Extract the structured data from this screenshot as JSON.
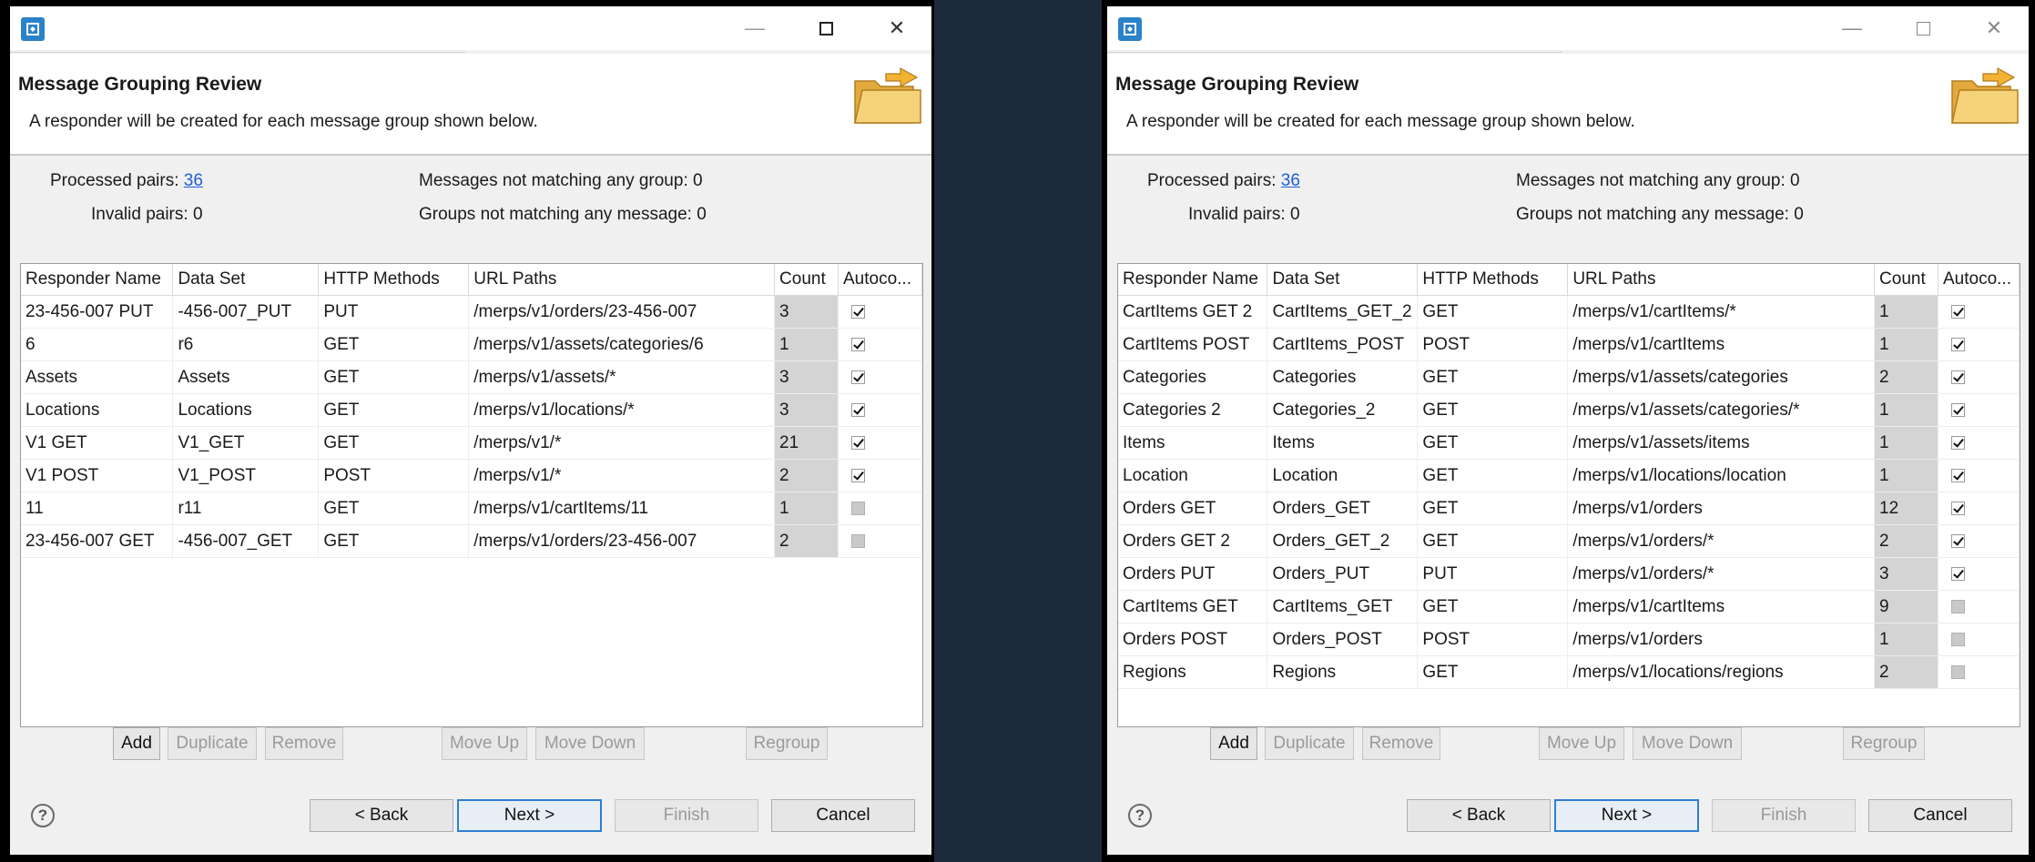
{
  "left": {
    "window": {
      "minimize": "—",
      "close": "✕"
    },
    "header": {
      "title": "Message Grouping Review",
      "description": "A responder will be created for each message group shown below."
    },
    "stats": {
      "processed_label": "Processed pairs:",
      "processed_value": "36",
      "invalid_label": "Invalid pairs:",
      "invalid_value": "0",
      "not_matching_group": "Messages not matching any group: 0",
      "not_matching_message": "Groups not matching any message: 0"
    },
    "table": {
      "columns": [
        "Responder Name",
        "Data Set",
        "HTTP Methods",
        "URL Paths",
        "Count",
        "Autoco..."
      ],
      "rows": [
        {
          "name": "23-456-007 PUT",
          "dataset": "-456-007_PUT",
          "method": "PUT",
          "url": "/merps/v1/orders/23-456-007",
          "count": "3",
          "auto": true
        },
        {
          "name": "6",
          "dataset": "r6",
          "method": "GET",
          "url": "/merps/v1/assets/categories/6",
          "count": "1",
          "auto": true
        },
        {
          "name": "Assets",
          "dataset": "Assets",
          "method": "GET",
          "url": "/merps/v1/assets/*",
          "count": "3",
          "auto": true
        },
        {
          "name": "Locations",
          "dataset": "Locations",
          "method": "GET",
          "url": "/merps/v1/locations/*",
          "count": "3",
          "auto": true
        },
        {
          "name": "V1 GET",
          "dataset": "V1_GET",
          "method": "GET",
          "url": "/merps/v1/*",
          "count": "21",
          "auto": true
        },
        {
          "name": "V1 POST",
          "dataset": "V1_POST",
          "method": "POST",
          "url": "/merps/v1/*",
          "count": "2",
          "auto": true
        },
        {
          "name": "11",
          "dataset": "r11",
          "method": "GET",
          "url": "/merps/v1/cartItems/11",
          "count": "1",
          "auto": false
        },
        {
          "name": "23-456-007 GET",
          "dataset": "-456-007_GET",
          "method": "GET",
          "url": "/merps/v1/orders/23-456-007",
          "count": "2",
          "auto": false
        }
      ]
    },
    "buttons": {
      "add": "Add",
      "duplicate": "Duplicate",
      "remove": "Remove",
      "move_up": "Move Up",
      "move_down": "Move Down",
      "regroup": "Regroup",
      "back": "< Back",
      "next": "Next >",
      "finish": "Finish",
      "cancel": "Cancel",
      "help": "?"
    }
  },
  "right": {
    "window": {
      "minimize": "—",
      "close": "✕"
    },
    "header": {
      "title": "Message Grouping Review",
      "description": "A responder will be created for each message group shown below."
    },
    "stats": {
      "processed_label": "Processed pairs:",
      "processed_value": "36",
      "invalid_label": "Invalid pairs:",
      "invalid_value": "0",
      "not_matching_group": "Messages not matching any group: 0",
      "not_matching_message": "Groups not matching any message: 0"
    },
    "table": {
      "columns": [
        "Responder Name",
        "Data Set",
        "HTTP Methods",
        "URL Paths",
        "Count",
        "Autoco..."
      ],
      "rows": [
        {
          "name": "CartItems GET 2",
          "dataset": "CartItems_GET_2",
          "method": "GET",
          "url": "/merps/v1/cartItems/*",
          "count": "1",
          "auto": true
        },
        {
          "name": "CartItems POST",
          "dataset": "CartItems_POST",
          "method": "POST",
          "url": "/merps/v1/cartItems",
          "count": "1",
          "auto": true
        },
        {
          "name": "Categories",
          "dataset": "Categories",
          "method": "GET",
          "url": "/merps/v1/assets/categories",
          "count": "2",
          "auto": true
        },
        {
          "name": "Categories 2",
          "dataset": "Categories_2",
          "method": "GET",
          "url": "/merps/v1/assets/categories/*",
          "count": "1",
          "auto": true
        },
        {
          "name": "Items",
          "dataset": "Items",
          "method": "GET",
          "url": "/merps/v1/assets/items",
          "count": "1",
          "auto": true
        },
        {
          "name": "Location",
          "dataset": "Location",
          "method": "GET",
          "url": "/merps/v1/locations/location",
          "count": "1",
          "auto": true
        },
        {
          "name": "Orders GET",
          "dataset": "Orders_GET",
          "method": "GET",
          "url": "/merps/v1/orders",
          "count": "12",
          "auto": true
        },
        {
          "name": "Orders GET 2",
          "dataset": "Orders_GET_2",
          "method": "GET",
          "url": "/merps/v1/orders/*",
          "count": "2",
          "auto": true
        },
        {
          "name": "Orders PUT",
          "dataset": "Orders_PUT",
          "method": "PUT",
          "url": "/merps/v1/orders/*",
          "count": "3",
          "auto": true
        },
        {
          "name": "CartItems GET",
          "dataset": "CartItems_GET",
          "method": "GET",
          "url": "/merps/v1/cartItems",
          "count": "9",
          "auto": false
        },
        {
          "name": "Orders POST",
          "dataset": "Orders_POST",
          "method": "POST",
          "url": "/merps/v1/orders",
          "count": "1",
          "auto": false
        },
        {
          "name": "Regions",
          "dataset": "Regions",
          "method": "GET",
          "url": "/merps/v1/locations/regions",
          "count": "2",
          "auto": false
        }
      ]
    },
    "buttons": {
      "add": "Add",
      "duplicate": "Duplicate",
      "remove": "Remove",
      "move_up": "Move Up",
      "move_down": "Move Down",
      "regroup": "Regroup",
      "back": "< Back",
      "next": "Next >",
      "finish": "Finish",
      "cancel": "Cancel",
      "help": "?"
    }
  }
}
